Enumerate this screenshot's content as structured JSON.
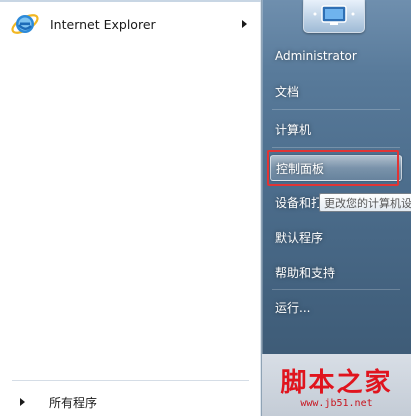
{
  "left": {
    "pinned": [
      {
        "label": "Internet Explorer",
        "icon": "internet-explorer-icon"
      }
    ],
    "all_programs_label": "所有程序"
  },
  "right": {
    "items": [
      {
        "label": "Administrator",
        "name": "right-item-administrator"
      },
      {
        "label": "文档",
        "name": "right-item-documents"
      },
      {
        "label": "计算机",
        "name": "right-item-computer"
      },
      {
        "label": "控制面板",
        "name": "right-item-control-panel",
        "highlighted": true
      },
      {
        "label": "设备和打印机",
        "name": "right-item-devices-printers"
      },
      {
        "label": "默认程序",
        "name": "right-item-default-programs"
      },
      {
        "label": "帮助和支持",
        "name": "right-item-help-support"
      },
      {
        "label": "运行...",
        "name": "right-item-run"
      }
    ]
  },
  "tooltip": "更改您的计算机设",
  "watermark": {
    "main": "脚本之家",
    "url": "www.jb51.net"
  },
  "colors": {
    "highlight_box": "#e23434",
    "watermark": "#e0141e"
  }
}
